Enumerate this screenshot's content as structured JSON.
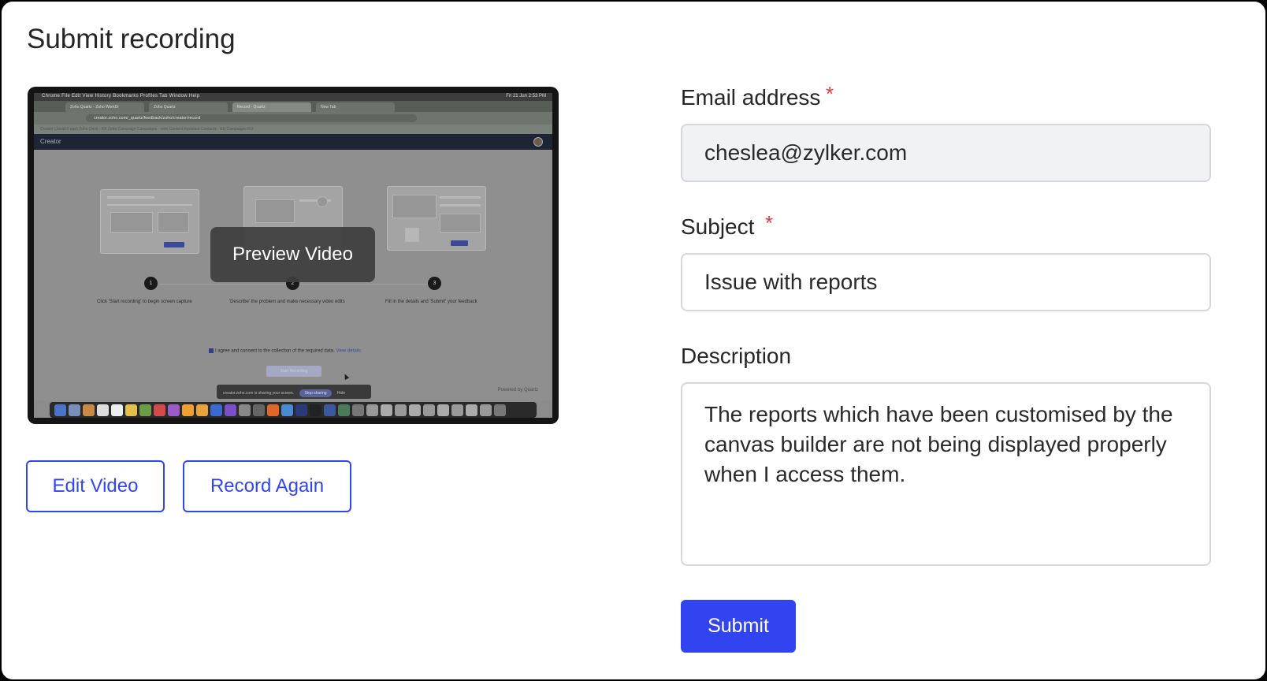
{
  "page": {
    "title": "Submit recording"
  },
  "video": {
    "preview_label": "Preview Video",
    "thumbnail": {
      "menubar": "Chrome   File   Edit   View   History   Bookmarks   Profiles   Tab   Window   Help",
      "menubar_clock": "Fri 21 Jun  2:53 PM",
      "tabs": [
        "Zoho Quartz - Zoho WorkDr",
        "Zoho Quartz",
        "Record - Quartz",
        "New Tab"
      ],
      "url": "creator.zoho.com/_quartz/feedback/zoho/creator/record",
      "bookmarks": "Creator (JavaEd app)    Zoho Desk - KB    Zoho Campaign    Campaigns - vern    Content Assistant    Contacts - EU    Campaigns EU",
      "app_name": "Creator",
      "steps": [
        {
          "num": "1",
          "caption": "Click 'Start recording' to begin screen capture"
        },
        {
          "num": "2",
          "caption": "'Describe' the problem and make necessary video edits"
        },
        {
          "num": "3",
          "caption": "Fill in the details and 'Submit' your feedback"
        }
      ],
      "consent": "I agree and consent to the collection of the required data.",
      "consent_link": "View details",
      "start_button": "Start Recording",
      "share_notice": "creator.zoho.com is sharing your screen.",
      "stop_sharing": "Stop sharing",
      "hide": "Hide",
      "powered_by": "Powered by Quartz"
    }
  },
  "buttons": {
    "edit_video": "Edit Video",
    "record_again": "Record Again",
    "submit": "Submit"
  },
  "form": {
    "email": {
      "label": "Email address",
      "required": "*",
      "value": "cheslea@zylker.com"
    },
    "subject": {
      "label": "Subject",
      "required": "*",
      "value": "Issue with reports"
    },
    "description": {
      "label": "Description",
      "value": "The reports which have been customised by the canvas builder are not being displayed properly when I access them."
    }
  },
  "colors": {
    "accent": "#3244f0",
    "required": "#e23b3b",
    "field_bg": "#f1f2f4"
  }
}
